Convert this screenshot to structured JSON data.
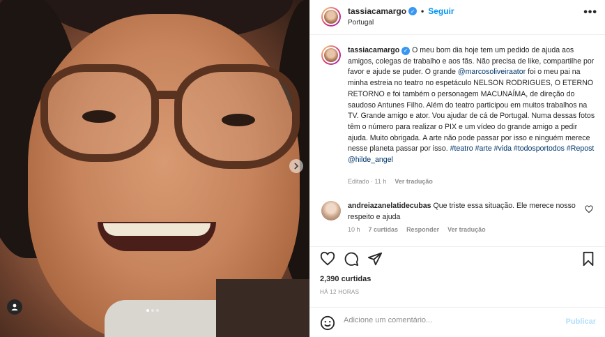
{
  "post": {
    "username": "tassiacamargo",
    "follow_label": "Seguir",
    "separator": "•",
    "location": "Portugal",
    "more_label": "•••",
    "media": {
      "slide_count": 3,
      "active_slide": 1
    }
  },
  "caption": {
    "username": "tassiacamargo",
    "text_1": " O meu bom dia hoje tem um pedido de ajuda aos amigos, colegas de trabalho e aos fãs. Não precisa de like, compartilhe por favor e ajude se puder. O grande ",
    "mention": "@marcosoliveiraator",
    "text_2": " foi o meu pai na minha estreia no teatro no espetáculo NELSON RODRIGUES, O ETERNO RETORNO e foi também o personagem MACUNAÍMA, de direção do saudoso Antunes Filho. Além do teatro participou em muitos trabalhos na TV. Grande amigo e ator. Vou ajudar de cá de Portugal. Numa dessas fotos têm o número para realizar o PIX e um vídeo do grande amigo a pedir ajuda. Muito obrigada. A arte não pode passar por isso e ninguém merece nesse planeta passar por isso. ",
    "hashtags": "#teatro #arte #vida #todosportodos #Repost @hilde_angel",
    "edited_label": "Editado · 11 h",
    "translate_label": "Ver tradução"
  },
  "comment": {
    "username": "andreiazanelatidecubas",
    "text": " Que triste essa situação. Ele merece nosso respeito e ajuda",
    "time": "10 h",
    "likes_label": "7 curtidas",
    "reply_label": "Responder",
    "translate_label": "Ver tradução"
  },
  "actions": {
    "likes": "2,390 curtidas",
    "posted": "HÁ 12 HORAS"
  },
  "add_comment": {
    "placeholder": "Adicione um comentário...",
    "post_label": "Publicar"
  },
  "colors": {
    "link": "#00376b",
    "follow": "#0095f6",
    "verified": "#3897f0",
    "muted": "#8e8e8e",
    "publish_disabled": "#b2dffc"
  }
}
